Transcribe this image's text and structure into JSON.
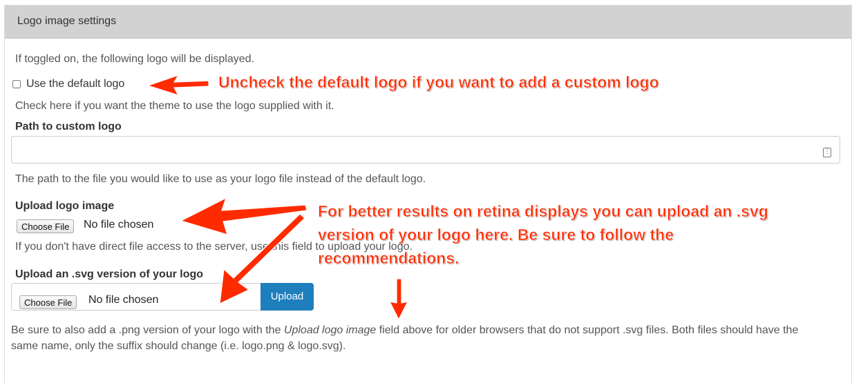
{
  "panel": {
    "title": "Logo image settings"
  },
  "intro_text": "If toggled on, the following logo will be displayed.",
  "default_logo": {
    "checkbox_label": "Use the default logo",
    "checked": false,
    "help": "Check here if you want the theme to use the logo supplied with it."
  },
  "custom_path": {
    "label": "Path to custom logo",
    "value": "",
    "help": "The path to the file you would like to use as your logo file instead of the default logo."
  },
  "upload_logo": {
    "label": "Upload logo image",
    "button_label": "Choose File",
    "status": "No file chosen",
    "help": "If you don't have direct file access to the server, use this field to upload your logo."
  },
  "upload_svg": {
    "label": "Upload an .svg version of your logo",
    "button_label": "Choose File",
    "status": "No file chosen",
    "upload_label": "Upload"
  },
  "note": {
    "part1": "Be sure to also add a .png version of your logo with the ",
    "emphasis": "Upload logo image",
    "part2": " field above for older browsers that do not support .svg files. Both files should have the same name, only the suffix should change (i.e. logo.png & logo.svg)."
  },
  "annotations": {
    "uncheck": "Uncheck the default logo if you want to add a custom logo",
    "retina_line1": "For better results on retina displays you can upload an .svg",
    "retina_line2": "version of your logo here. Be sure to follow the",
    "retina_line3": "recommendations."
  },
  "colors": {
    "annotation": "#ff2b00",
    "upload_button": "#1f7fbd",
    "header_bg": "#d2d2d2"
  }
}
